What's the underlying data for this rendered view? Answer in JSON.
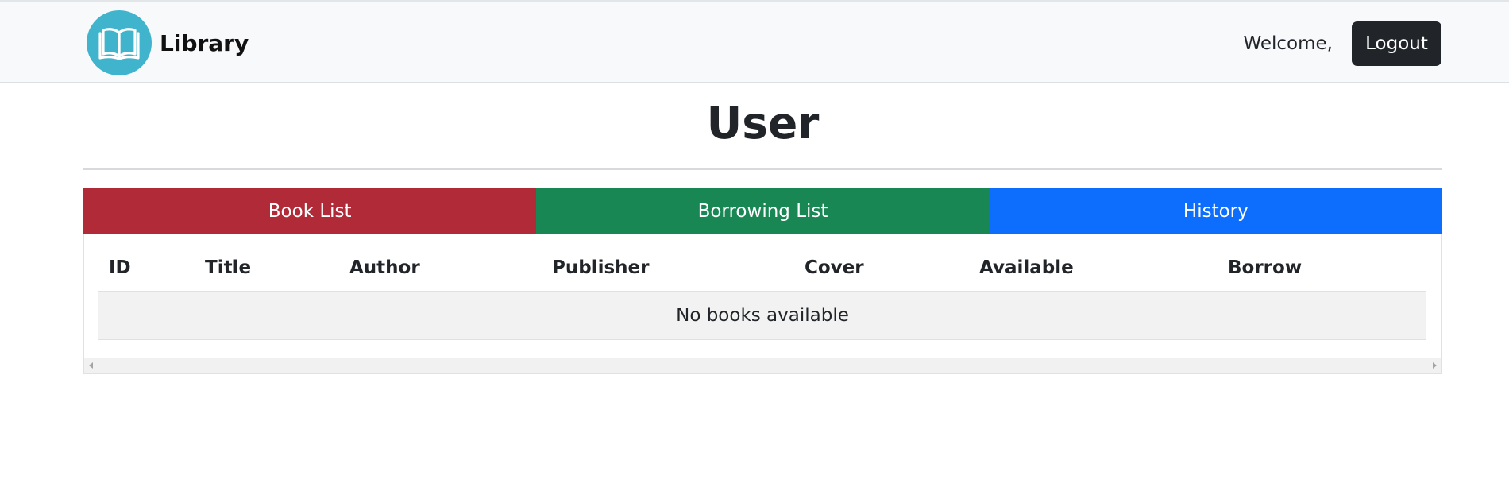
{
  "navbar": {
    "brand": "Library",
    "welcome": "Welcome,",
    "logout_label": "Logout"
  },
  "page": {
    "title": "User"
  },
  "tabs": [
    {
      "label": "Book List",
      "color": "#b02a37"
    },
    {
      "label": "Borrowing List",
      "color": "#198754"
    },
    {
      "label": "History",
      "color": "#0d6efd"
    }
  ],
  "table": {
    "columns": [
      "ID",
      "Title",
      "Author",
      "Publisher",
      "Cover",
      "Available",
      "Borrow"
    ],
    "empty_message": "No books available"
  },
  "colors": {
    "logo_bg": "#3fb4cc",
    "navbar_bg": "#f8f9fa",
    "logout_bg": "#212529"
  }
}
